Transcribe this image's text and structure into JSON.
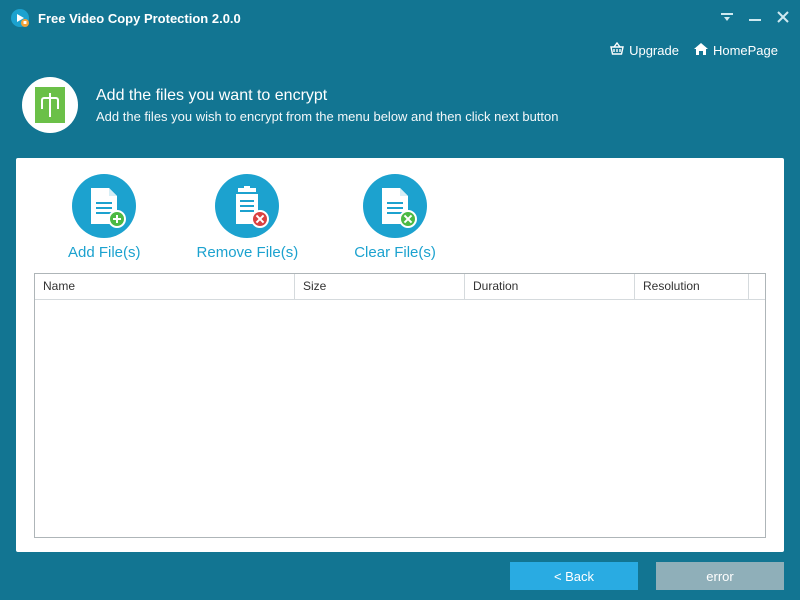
{
  "app": {
    "title": "Free Video Copy Protection 2.0.0"
  },
  "header": {
    "upgrade": "Upgrade",
    "homepage": "HomePage"
  },
  "banner": {
    "title": "Add the files you want to encrypt",
    "subtitle": "Add the files you wish to encrypt from the menu below and then click next button"
  },
  "actions": {
    "add": "Add File(s)",
    "remove": "Remove File(s)",
    "clear": "Clear File(s)"
  },
  "table": {
    "columns": {
      "name": "Name",
      "size": "Size",
      "duration": "Duration",
      "resolution": "Resolution"
    },
    "rows": []
  },
  "footer": {
    "back": "< Back",
    "error": "error"
  }
}
